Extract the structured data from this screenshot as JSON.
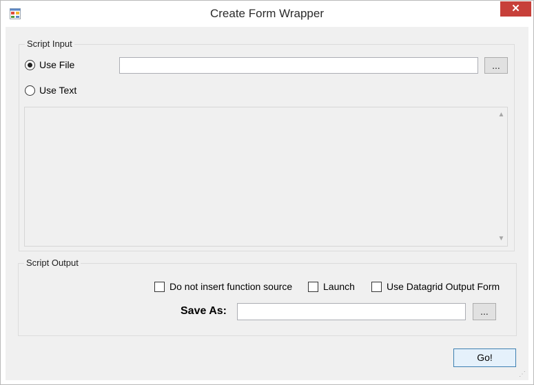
{
  "window": {
    "title": "Create Form Wrapper",
    "close_glyph": "✕"
  },
  "script_input": {
    "group_title": "Script Input",
    "use_file_label": "Use File",
    "use_file_selected": true,
    "file_path_value": "",
    "browse_label": "...",
    "use_text_label": "Use Text",
    "use_text_selected": false,
    "script_text_value": ""
  },
  "script_output": {
    "group_title": "Script Output",
    "no_function_source_label": "Do not insert function source",
    "no_function_source_checked": false,
    "launch_label": "Launch",
    "launch_checked": false,
    "datagrid_label": "Use Datagrid Output Form",
    "datagrid_checked": false,
    "save_as_label": "Save As:",
    "save_as_value": "",
    "browse_label": "..."
  },
  "go_label": "Go!",
  "colors": {
    "close_button": "#c7403a",
    "client_background": "#f0f0f0",
    "default_button_border": "#3c7fb1"
  }
}
